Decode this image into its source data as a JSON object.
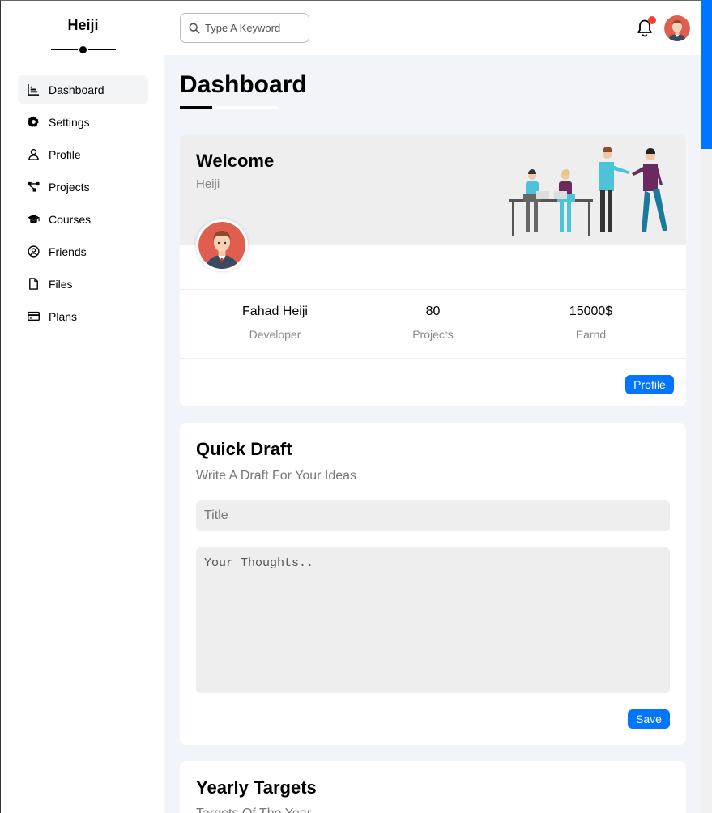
{
  "sidebar": {
    "brand": "Heiji",
    "items": [
      {
        "label": "Dashboard",
        "icon": "chart-icon",
        "active": true
      },
      {
        "label": "Settings",
        "icon": "gear-icon"
      },
      {
        "label": "Profile",
        "icon": "user-icon"
      },
      {
        "label": "Projects",
        "icon": "diagram-icon"
      },
      {
        "label": "Courses",
        "icon": "graduation-cap-icon"
      },
      {
        "label": "Friends",
        "icon": "user-circle-icon"
      },
      {
        "label": "Files",
        "icon": "file-icon"
      },
      {
        "label": "Plans",
        "icon": "credit-card-icon"
      }
    ]
  },
  "topbar": {
    "search_placeholder": "Type A Keyword",
    "notification_dot_color": "#f44336"
  },
  "main": {
    "title": "Dashboard",
    "welcome": {
      "title": "Welcome",
      "subtitle": "Heiji",
      "stats": [
        {
          "value": "Fahad Heiji",
          "label": "Developer"
        },
        {
          "value": "80",
          "label": "Projects"
        },
        {
          "value": "15000$",
          "label": "Earnd"
        }
      ],
      "profile_button": "Profile"
    },
    "quick_draft": {
      "title": "Quick Draft",
      "subtitle": "Write A Draft For Your Ideas",
      "title_placeholder": "Title",
      "body_placeholder": "Your Thoughts..",
      "save_button": "Save"
    },
    "yearly_targets": {
      "title": "Yearly Targets",
      "subtitle": "Targets Of The Year"
    }
  },
  "colors": {
    "accent": "#0075ff",
    "background": "#f1f5f9"
  }
}
